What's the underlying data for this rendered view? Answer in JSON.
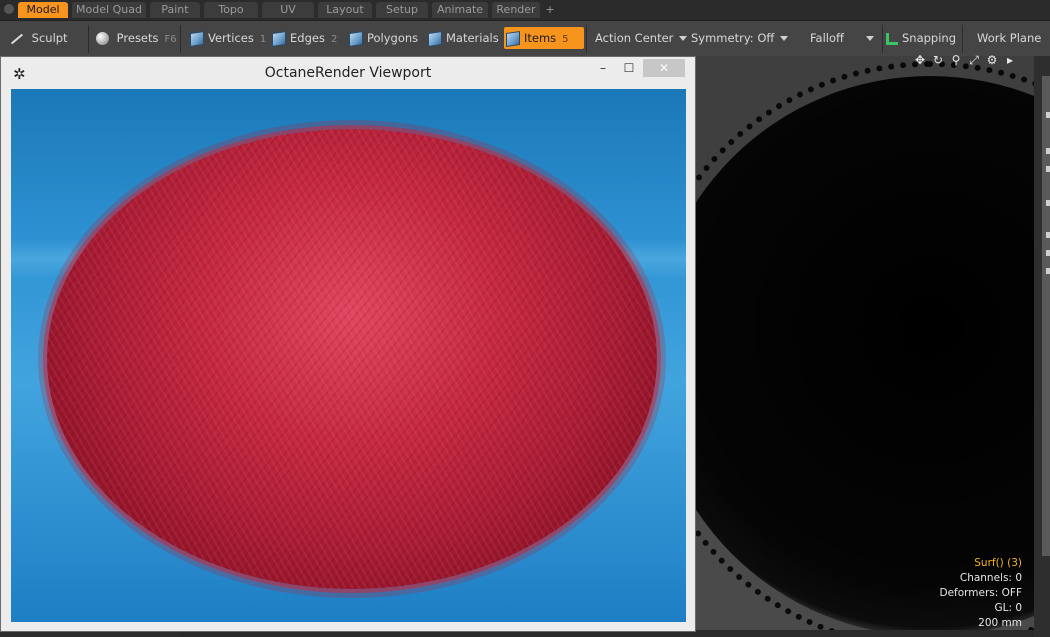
{
  "tabs": {
    "items": [
      {
        "label": "Model",
        "active": true
      },
      {
        "label": "Model Quad"
      },
      {
        "label": "Paint"
      },
      {
        "label": "Topo"
      },
      {
        "label": "UV"
      },
      {
        "label": "Layout"
      },
      {
        "label": "Setup"
      },
      {
        "label": "Animate"
      },
      {
        "label": "Render"
      }
    ],
    "add_label": "+"
  },
  "toolbar": {
    "sculpt": "Sculpt",
    "presets": "Presets",
    "presets_key": "F6",
    "vertices": "Vertices",
    "vertices_key": "1",
    "edges": "Edges",
    "edges_key": "2",
    "polygons": "Polygons",
    "materials": "Materials",
    "items": "Items",
    "items_key": "5",
    "action_center": "Action Center",
    "symmetry": "Symmetry: Off",
    "falloff": "Falloff",
    "snapping": "Snapping",
    "work_plane": "Work Plane"
  },
  "octane": {
    "title": "OctaneRender Viewport",
    "minimize": "–",
    "maximize": "☐",
    "close": "✕"
  },
  "viewport_stats": {
    "surf": "Surf() (3)",
    "channels": "Channels: 0",
    "deformers": "Deformers: OFF",
    "gl": "GL: 0",
    "scale": "200 mm"
  },
  "colors": {
    "accent": "#f7941d",
    "render_bg": "#2f93d3",
    "fur": "#c42840"
  }
}
